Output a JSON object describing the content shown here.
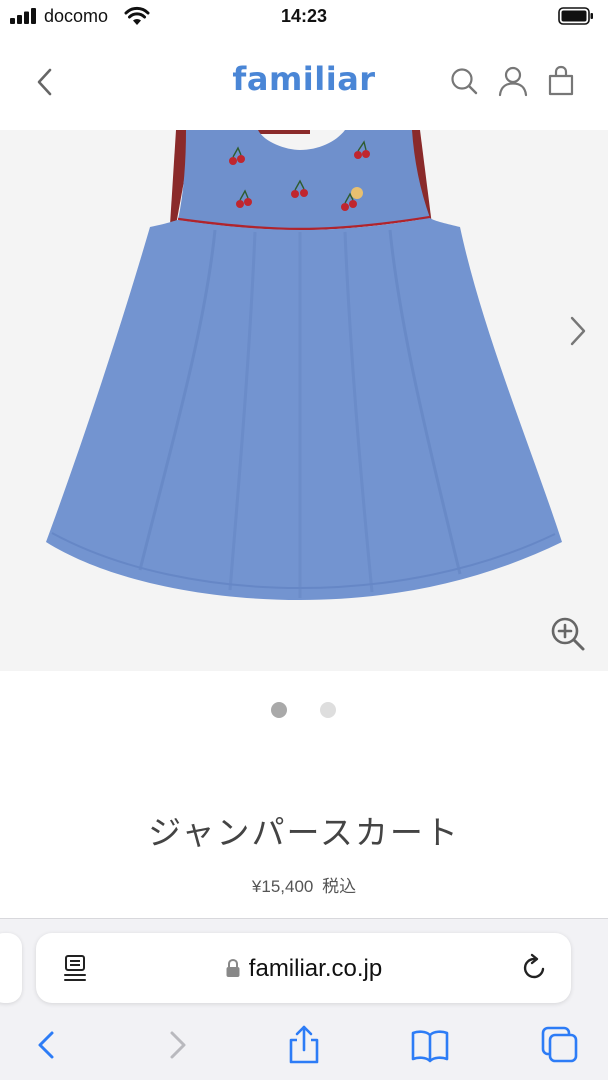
{
  "status_bar": {
    "carrier": "docomo",
    "time": "14:23"
  },
  "header": {
    "brand": "familiar",
    "brand_color": "#4a86d6",
    "icons": [
      "back-chevron-icon",
      "search-icon",
      "account-icon",
      "cart-icon"
    ]
  },
  "gallery": {
    "current_slide": 1,
    "total_slides": 2,
    "image_subject": "blue chambray jumper skirt with cherry embroidery",
    "controls": [
      "next-arrow-icon",
      "zoom-in-icon"
    ]
  },
  "product": {
    "name": "ジャンパースカート",
    "price": "¥15,400",
    "tax_label": "税込"
  },
  "browser": {
    "url": "familiar.co.jp",
    "accent_color": "#2d7cf6",
    "toolbar": [
      "back",
      "forward",
      "share",
      "bookmarks",
      "tabs"
    ]
  }
}
